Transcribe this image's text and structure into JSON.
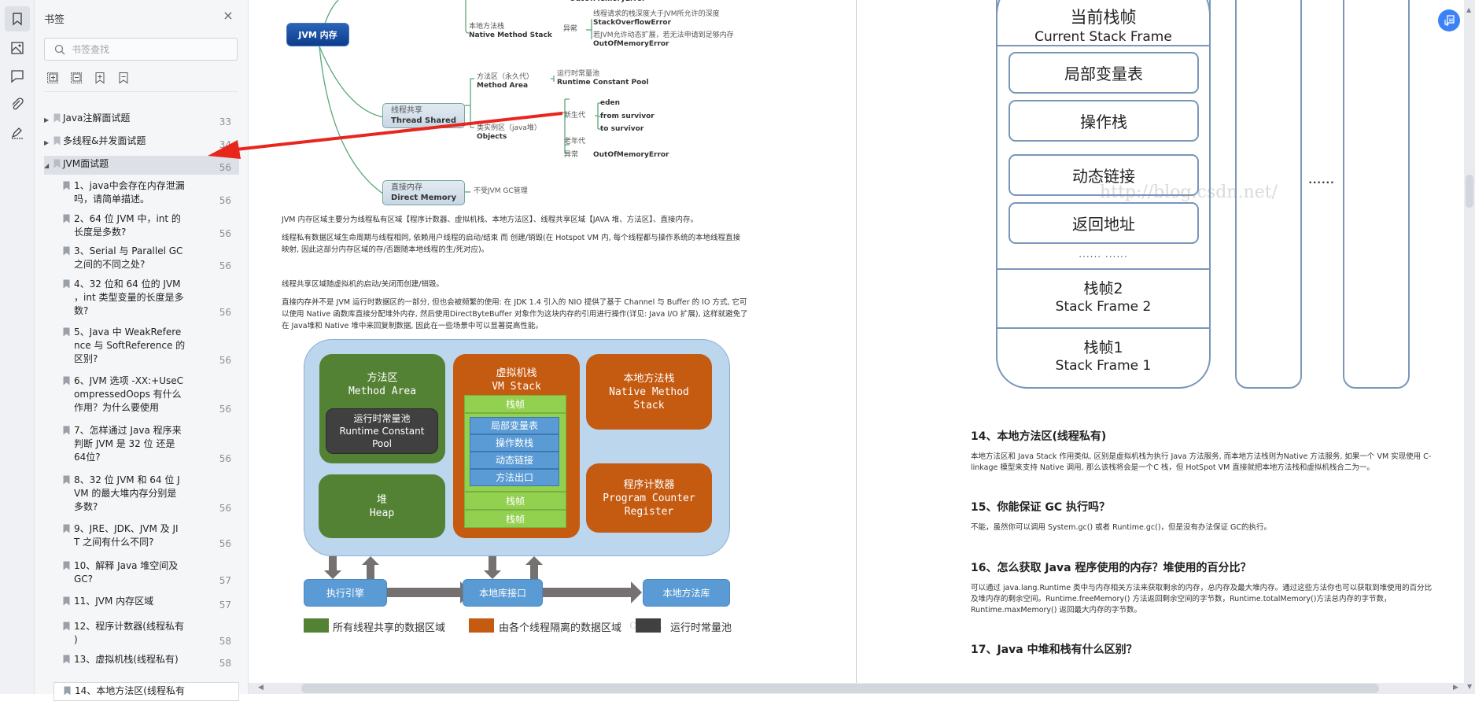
{
  "rail": {
    "icons": [
      "bookmark-icon",
      "image-icon",
      "comment-icon",
      "attachment-icon",
      "signature-icon"
    ]
  },
  "panel": {
    "title": "书签",
    "close": "×",
    "search_placeholder": "书签查找",
    "tools": [
      "expand-all-icon",
      "collapse-all-icon",
      "add-bookmark-icon",
      "remove-bookmark-icon"
    ]
  },
  "bookmarks": [
    {
      "label": "Java注解面试题",
      "page": "33",
      "expandable": true
    },
    {
      "label": "多线程&并发面试题",
      "page": "34",
      "expandable": true
    },
    {
      "label": "JVM面试题",
      "page": "56",
      "expanded": true,
      "selected": true
    },
    {
      "label1": "1、java中会存在内存泄漏",
      "label2": "吗，请简单描述。",
      "page": "56"
    },
    {
      "label1": "2、64 位 JVM 中，int 的",
      "label2": "长度是多数?",
      "page": "56"
    },
    {
      "label1": "3、Serial 与 Parallel GC",
      "label2": "之间的不同之处?",
      "page": "56"
    },
    {
      "label1": "4、32 位和 64 位的 JVM",
      "label2": "，int 类型变量的长度是多",
      "label3": "数?",
      "page": "56"
    },
    {
      "label1": "5、Java 中 WeakRefere",
      "label2": "nce 与 SoftReference 的",
      "label3": "区别?",
      "page": "56"
    },
    {
      "label1": "6、JVM 选项 -XX:+UseC",
      "label2": "ompressedOops 有什么",
      "label3": "作用？为什么要使用",
      "page": "56"
    },
    {
      "label1": "7、怎样通过 Java 程序来",
      "label2": "判断 JVM 是 32 位 还是",
      "label3": "64位?",
      "page": "56"
    },
    {
      "label1": "8、32 位 JVM 和 64 位 J",
      "label2": "VM 的最大堆内存分别是",
      "label3": "多数?",
      "page": "56"
    },
    {
      "label1": "9、JRE、JDK、JVM 及 JI",
      "label2": "T 之间有什么不同?",
      "page": "56"
    },
    {
      "label1": "10、解释 Java 堆空间及",
      "label2": "GC?",
      "page": "57"
    },
    {
      "label1": "11、JVM 内存区域",
      "page": "57"
    },
    {
      "label1": "12、程序计数器(线程私有",
      "label2": ")",
      "page": "58"
    },
    {
      "label1": "13、虚拟机栈(线程私有)",
      "page": "58"
    },
    {
      "label1": "14、本地方法区(线程私有",
      "page": ""
    }
  ],
  "mindmap": {
    "root": "JVM 内存",
    "top_cut": "OutOfMemoryError",
    "native_stack_cn": "本地方法栈",
    "native_stack_en": "Native Method Stack",
    "exception": "异常",
    "so_cond": "线程请求的栈深度大于JVM所允许的深度",
    "so_err": "StackOverflowError",
    "oom_cond": "若JVM允许动态扩展，若无法申请到足够内存",
    "oom_err": "OutOfMemoryError",
    "shared_cn": "线程共享",
    "shared_en": "Thread Shared",
    "method_area_cn": "方法区（永久代）",
    "method_area_en": "Method Area",
    "rcp_cn": "运行时常量池",
    "rcp_en": "Runtime Constant Pool",
    "objects_cn": "类实例区（java堆）",
    "objects_en": "Objects",
    "young": "新生代",
    "eden": "eden",
    "from": "from survivor",
    "to": "to survivor",
    "old": "老年代",
    "heap_exc": "异常",
    "heap_oom": "OutOfMemoryError",
    "direct_cn": "直接内存",
    "direct_en": "Direct Memory",
    "direct_note": "不受JVM GC管理"
  },
  "left_paragraphs": [
    "JVM 内存区域主要分为线程私有区域【程序计数器、虚拟机栈、本地方法区】、线程共享区域【JAVA 堆、方法区】、直接内存。",
    "线程私有数据区域生命周期与线程相同, 依赖用户线程的启动/结束 而 创建/销毁(在 Hotspot VM 内, 每个线程都与操作系统的本地线程直接",
    "映射, 因此这部分内存区域的存/否跟随本地线程的生/死对应)。",
    "线程共享区域随虚拟机的启动/关闭而创建/销毁。",
    "直接内存并不是 JVM 运行时数据区的一部分, 但也会被频繁的使用: 在 JDK 1.4 引入的 NIO 提供了基于 Channel 与 Buffer 的 IO 方式, 它可",
    "以使用 Native 函数库直接分配堆外内存, 然后使用DirectByteBuffer 对象作为这块内存的引用进行操作(详见: Java I/O 扩展), 这样就避免了",
    "在 Java堆和 Native 堆中来回复制数据, 因此在一些场景中可以显著提高性能。"
  ],
  "runtime_diagram": {
    "method_area_cn": "方法区",
    "method_area_en": "Method Area",
    "rcp_cn": "运行时常量池",
    "rcp_en1": "Runtime Constant",
    "rcp_en2": "Pool",
    "heap_cn": "堆",
    "heap_en": "Heap",
    "vm_stack_cn": "虚拟机栈",
    "vm_stack_en": "VM Stack",
    "frame": "栈帧",
    "frame_items": [
      "局部变量表",
      "操作数栈",
      "动态链接",
      "方法出口"
    ],
    "native_cn": "本地方法栈",
    "native_en1": "Native Method",
    "native_en2": "Stack",
    "pc_cn": "程序计数器",
    "pc_en1": "Program Counter",
    "pc_en2": "Register",
    "engine": "执行引擎",
    "native_iface": "本地库接口",
    "native_lib": "本地方法库",
    "legend": [
      {
        "label": "所有线程共享的数据区域",
        "color": "#548235"
      },
      {
        "label": "由各个线程隔离的数据区域",
        "color": "#c55a11"
      },
      {
        "label": "运行时常量池",
        "color": "#404040"
      }
    ],
    "watermark": "csdn."
  },
  "stack_frame_diagram": {
    "current_cn": "当前栈帧",
    "current_en": "Current Stack Frame",
    "items": [
      "局部变量表",
      "操作栈",
      "动态链接",
      "返回地址"
    ],
    "dots": "...... ......",
    "frame2_cn": "栈帧2",
    "frame2_en": "Stack Frame 2",
    "frame1_cn": "栈帧1",
    "frame1_en": "Stack Frame 1",
    "side_dots": "......",
    "watermark": "http://blog.csdn.net/"
  },
  "right_sections": [
    {
      "heading": "14、本地方法区(线程私有)",
      "lines": [
        "本地方法区和 Java Stack 作用类似, 区别是虚拟机栈为执行 Java 方法服务, 而本地方法栈则为Native 方法服务, 如果一个 VM 实现使用 C-",
        "linkage 模型来支持 Native 调用, 那么该栈将会是一个C 栈，但 HotSpot VM 直接就把本地方法栈和虚拟机栈合二为一。"
      ]
    },
    {
      "heading": "15、你能保证 GC 执行吗？",
      "lines": [
        "不能，虽然你可以调用 System.gc() 或者 Runtime.gc()，但是没有办法保证 GC的执行。"
      ]
    },
    {
      "heading": "16、怎么获取 Java 程序使用的内存？堆使用的百分比？",
      "lines": [
        "可以通过 java.lang.Runtime 类中与内存相关方法来获取剩余的内存，总内存及最大堆内存。通过这些方法你也可以获取到堆使用的百分比",
        "及堆内存的剩余空间。Runtime.freeMemory() 方法返回剩余空间的字节数，Runtime.totalMemory()方法总内存的字节数，",
        "Runtime.maxMemory() 返回最大内存的字节数。"
      ]
    },
    {
      "heading": "17、Java 中堆和栈有什么区别？",
      "lines": []
    }
  ],
  "colors": {
    "accent": "#3b82f6",
    "annotation_arrow": "#e8261e",
    "selected_row": "#dde0e6"
  }
}
